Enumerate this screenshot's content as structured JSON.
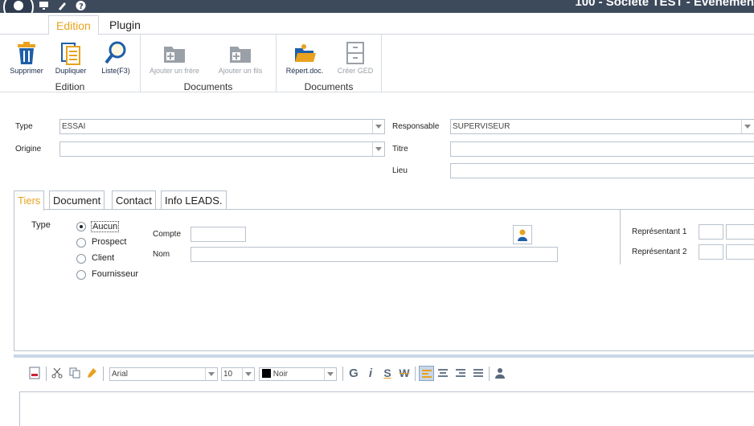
{
  "window": {
    "title": "100 - Société TEST - Evènemen"
  },
  "ribbon_tabs": [
    {
      "label": "Edition"
    },
    {
      "label": "Plugin"
    }
  ],
  "ribbon": {
    "groups": [
      {
        "title": "Edition",
        "buttons": [
          {
            "label": "Supprimer",
            "icon": "trash-icon"
          },
          {
            "label": "Dupliquer",
            "icon": "duplicate-icon"
          },
          {
            "label": "Liste(F3)",
            "icon": "magnifier-icon"
          }
        ]
      },
      {
        "title": "Documents",
        "buttons": [
          {
            "label": "Ajouter un frère",
            "icon": "folder-add-icon"
          },
          {
            "label": "Ajouter un  fils",
            "icon": "folder-add-icon"
          }
        ]
      },
      {
        "title": "Documents",
        "buttons": [
          {
            "label": "Répert.doc.",
            "icon": "folder-open-icon"
          },
          {
            "label": "Créer GED",
            "icon": "cabinet-icon"
          }
        ]
      }
    ]
  },
  "form": {
    "type_label": "Type",
    "type_value": "ESSAI",
    "origine_label": "Origine",
    "origine_value": "",
    "responsable_label": "Responsable",
    "responsable_value": "SUPERVISEUR",
    "titre_label": "Titre",
    "titre_value": "",
    "lieu_label": "Lieu",
    "lieu_value": ""
  },
  "inner_tabs": [
    {
      "label": "Tiers"
    },
    {
      "label": "Document"
    },
    {
      "label": "Contact"
    },
    {
      "label": "Info LEADS."
    }
  ],
  "tiers": {
    "type_label": "Type",
    "options": [
      {
        "label": "Aucun",
        "checked": true
      },
      {
        "label": "Prospect",
        "checked": false
      },
      {
        "label": "Client",
        "checked": false
      },
      {
        "label": "Fournisseur",
        "checked": false
      }
    ],
    "compte_label": "Compte",
    "compte_value": "",
    "nom_label": "Nom",
    "nom_value": "",
    "rep1_label": "Représentant 1",
    "rep2_label": "Représentant 2"
  },
  "editor_toolbar": {
    "font": "Arial",
    "size": "10",
    "color_label": "Noir",
    "color_value": "#000000",
    "bold_glyph": "G",
    "italic_glyph": "i",
    "underline_glyph": "S",
    "strike_glyph": "W"
  },
  "colors": {
    "accent": "#e8a21e",
    "topbar": "#3d4a5c",
    "border": "#b9c2cc"
  }
}
